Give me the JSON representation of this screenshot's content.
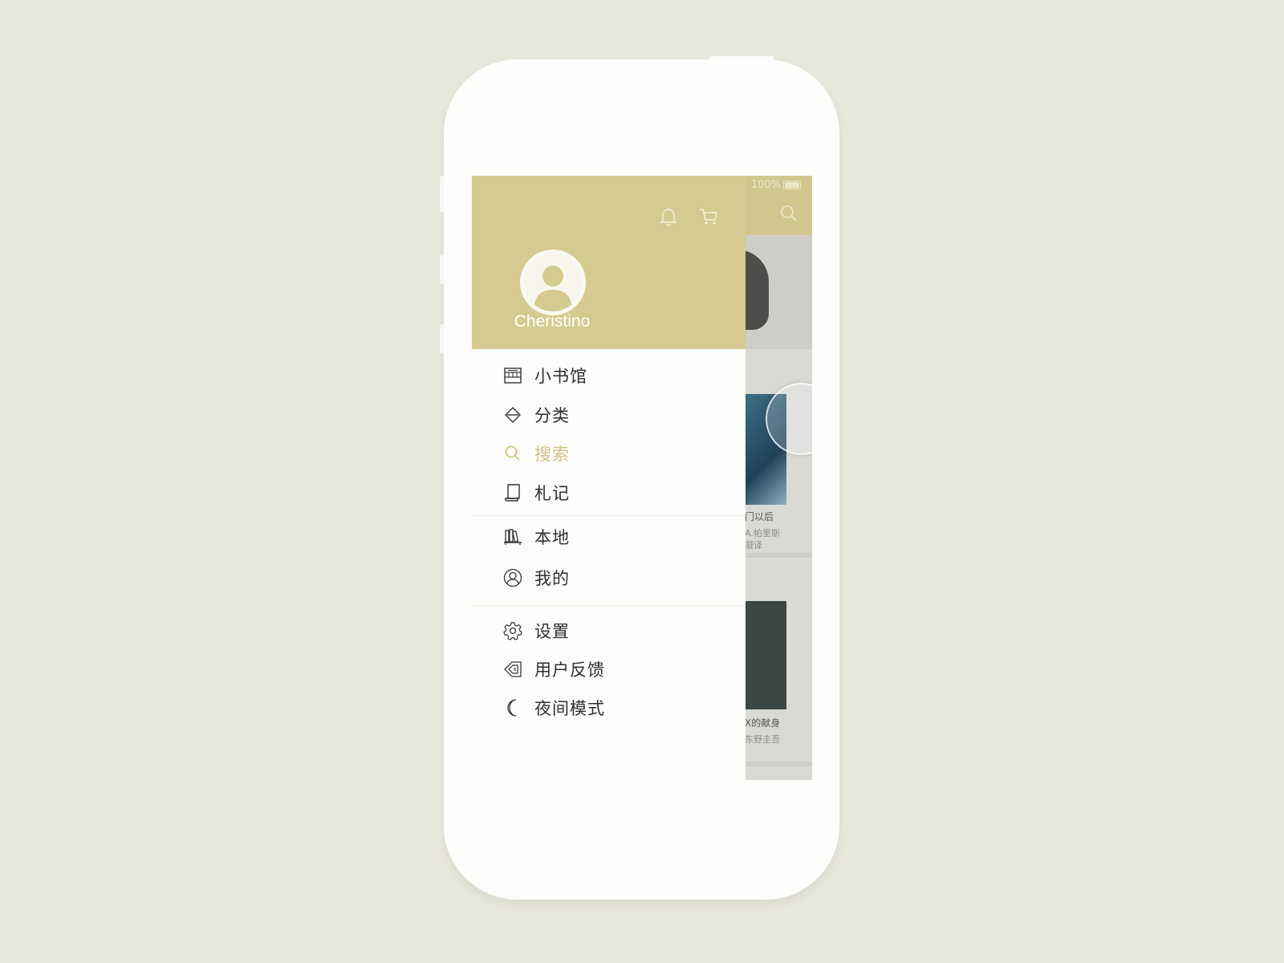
{
  "colors": {
    "page_bg": "#e8e7dc",
    "accent": "#d5ca8f",
    "active_text": "#cfc183",
    "text": "#2f2f2f"
  },
  "background_app": {
    "status_battery": "100%",
    "book1": {
      "title": "门以后",
      "author": "A.帕里斯",
      "translator": "凝译"
    },
    "book2": {
      "title": "X的献身",
      "author": "东野圭吾"
    }
  },
  "drawer": {
    "username": "Cheristino",
    "header_icons": [
      "bell-icon",
      "cart-icon"
    ],
    "menu_group1": [
      {
        "label": "小书馆",
        "icon": "bookstore-icon"
      },
      {
        "label": "分类",
        "icon": "category-icon"
      },
      {
        "label": "搜索",
        "icon": "search-icon",
        "active": true
      },
      {
        "label": "札记",
        "icon": "notes-icon"
      }
    ],
    "menu_group2": [
      {
        "label": "本地",
        "icon": "local-shelf-icon"
      },
      {
        "label": "我的",
        "icon": "profile-icon"
      }
    ],
    "menu_group3": [
      {
        "label": "设置",
        "icon": "gear-icon"
      },
      {
        "label": "用户反馈",
        "icon": "feedback-icon"
      },
      {
        "label": "夜间模式",
        "icon": "moon-icon"
      }
    ]
  }
}
